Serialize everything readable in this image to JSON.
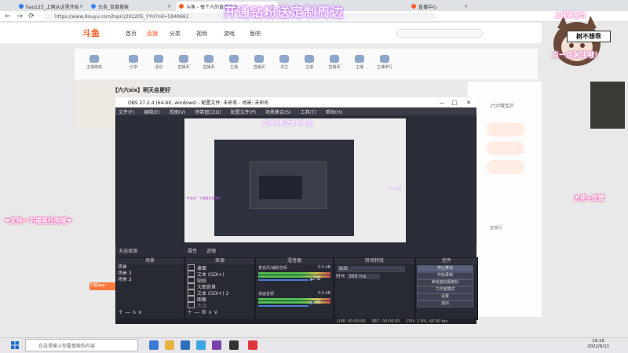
{
  "browser": {
    "tabs": [
      {
        "label": "hao123_上网从这里开始",
        "color": "#2b7de9"
      },
      {
        "label": "头条_百度搜索",
        "color": "#3385ff"
      },
      {
        "label": "斗鱼 - 每个人的直播平台",
        "color": "#ff5d23"
      },
      {
        "label": "直播中心",
        "color": "#ff5d23"
      }
    ],
    "url": "https://www.douyu.com/topic/202205_YYH?rid=5949661"
  },
  "site": {
    "logo": "斗鱼",
    "nav": [
      "首页",
      "直播",
      "分类",
      "视频",
      "游戏",
      "鱼吧"
    ],
    "room_icons": [
      "主播等级",
      "分享",
      "活动",
      "直播间",
      "直播间",
      "主播",
      "直播间",
      "关注",
      "主播",
      "直播间",
      "主播",
      "主播排行"
    ],
    "room_title": "【六六six】明天会更好",
    "right_text": "六六哦宝贝",
    "right_link": "直播间",
    "bottom_ad": "下载App"
  },
  "overlay": {
    "banner": "开通钻粉送定制周边",
    "left_text": "❤支持一下福星任务哦❤",
    "right_text": "大佬=房管",
    "sign_top": "上周锦卷员",
    "sign_mid": "树不想乖",
    "sign_bottom": "点一点关注哦！"
  },
  "obs": {
    "title": "OBS 27.2.4 (64-bit, windows) - 配置文件: 未命名 - 场景: 未命名",
    "menu": [
      "文件(F)",
      "编辑(E)",
      "视图(V)",
      "停靠窗口(D)",
      "配置文件(P)",
      "场景集合(S)",
      "工具(T)",
      "帮助(H)"
    ],
    "preview_banner": "开通钻粉送定制周边",
    "preview_left": "❤支持一下福星任务哦❤",
    "preview_right": "大佬=房管",
    "ctrl_hint": "未选择源",
    "ctrl_props": "属性",
    "ctrl_filters": "滤镜",
    "docks": {
      "scenes": {
        "title": "场景",
        "items": [
          "场景",
          "场景 3",
          "场景 2"
        ]
      },
      "sources": {
        "title": "来源",
        "items": [
          "桌面",
          "文本 (GDI+)",
          "贴纸",
          "大图背景",
          "文本 (GDI+) 2",
          "图像",
          "大汉"
        ]
      },
      "mixer": {
        "title": "混音器",
        "channels": [
          {
            "name": "麦克风/辅助音频",
            "db": "0.0 dB"
          },
          {
            "name": "桌面音频",
            "db": "0.0 dB"
          }
        ]
      },
      "transitions": {
        "title": "转场特效",
        "type": "淡出",
        "duration_label": "时长",
        "duration_value": "300 ms"
      },
      "controls": {
        "title": "控件",
        "buttons": [
          "停止推流",
          "开始录制",
          "启动虚拟摄像机",
          "工作室模式",
          "设置",
          "退出"
        ]
      }
    },
    "status": [
      "LIVE: 00:00:00",
      "REC: 00:00:00",
      "CPU: 1.9%, 60.00 fps"
    ]
  },
  "taskbar": {
    "search_placeholder": "在这里输入你要搜索的内容",
    "time": "19:15",
    "date": "2022/6/11"
  },
  "colors": {
    "accent": "#ff5d23",
    "obs_bg": "#2b2e38",
    "overlay_glow": "#c25bff"
  }
}
